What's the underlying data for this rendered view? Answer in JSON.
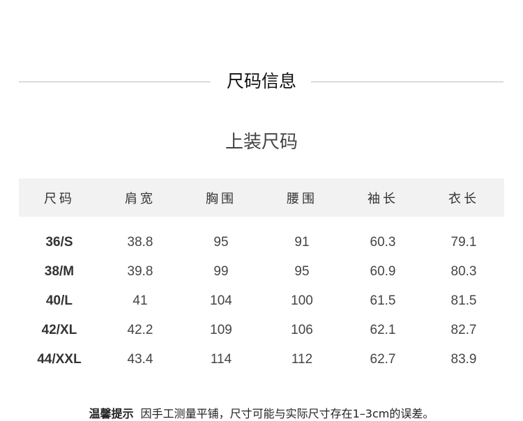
{
  "section_title": "尺码信息",
  "subtitle": "上装尺码",
  "table": {
    "headers": [
      "尺码",
      "肩宽",
      "胸围",
      "腰围",
      "袖长",
      "衣长"
    ],
    "rows": [
      [
        "36/S",
        "38.8",
        "95",
        "91",
        "60.3",
        "79.1"
      ],
      [
        "38/M",
        "39.8",
        "99",
        "95",
        "60.9",
        "80.3"
      ],
      [
        "40/L",
        "41",
        "104",
        "100",
        "61.5",
        "81.5"
      ],
      [
        "42/XL",
        "42.2",
        "109",
        "106",
        "62.1",
        "82.7"
      ],
      [
        "44/XXL",
        "43.4",
        "114",
        "112",
        "62.7",
        "83.9"
      ]
    ]
  },
  "note": {
    "label": "温馨提示",
    "text": "因手工测量平铺，尺寸可能与实际尺寸存在1–3cm的误差。"
  }
}
